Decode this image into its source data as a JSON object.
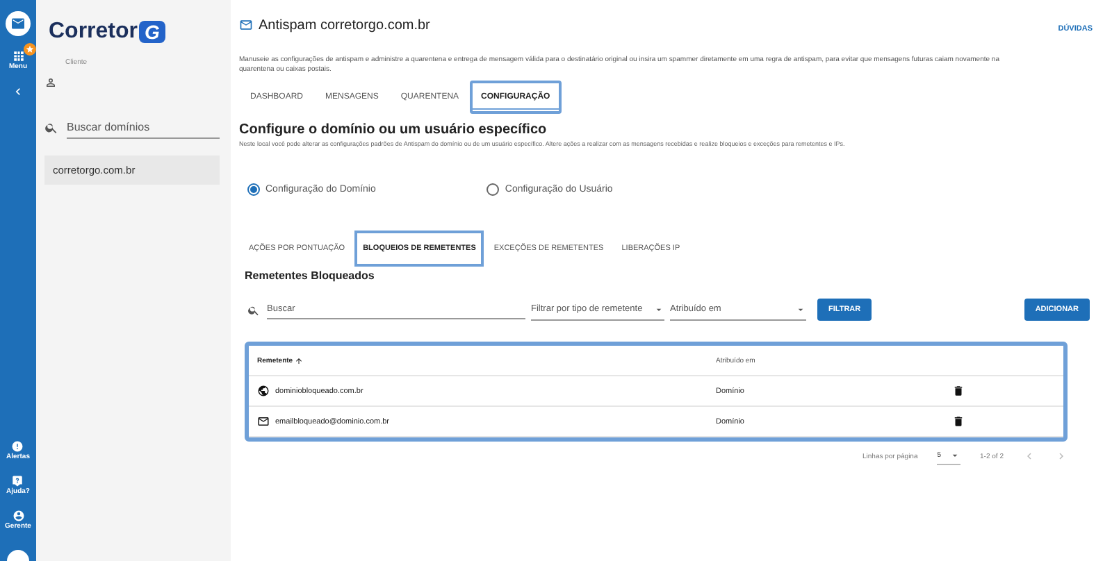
{
  "rail": {
    "top": [
      {
        "kind": "mail"
      },
      {
        "kind": "menu",
        "label": "Menu"
      },
      {
        "kind": "collapse"
      }
    ],
    "bottom": [
      {
        "kind": "alert",
        "label": "Alertas"
      },
      {
        "kind": "help",
        "label": "Ajuda?"
      },
      {
        "kind": "user",
        "label": "Gerente"
      }
    ]
  },
  "sidebar": {
    "logo": {
      "text": "Corretor",
      "badge": "G"
    },
    "client_label": "Cliente",
    "search": {
      "placeholder": "Buscar domínios"
    },
    "domains": [
      {
        "name": "corretorgo.com.br",
        "selected": true
      }
    ]
  },
  "header": {
    "title": "Antispam corretorgo.com.br",
    "help": "DÚVIDAS",
    "description": "Manuseie as configurações de antispam e administre a quarentena e entrega de mensagem válida para o destinatário original ou insira um spammer diretamente em uma regra de antispam, para evitar que mensagens futuras caiam novamente na quarentena ou caixas postais."
  },
  "tabs": [
    {
      "label": "DASHBOARD",
      "selected": false
    },
    {
      "label": "MENSAGENS",
      "selected": false
    },
    {
      "label": "QUARENTENA",
      "selected": false
    },
    {
      "label": "CONFIGURAÇÃO",
      "selected": true
    }
  ],
  "config": {
    "title": "Configure o domínio ou um usuário específico",
    "description": "Neste local você pode alterar as configurações padrões de Antispam do domínio ou de um usuário específico. Altere ações a realizar com as mensagens recebidas e realize bloqueios e exceções para remetentes e IPs.",
    "scope": [
      {
        "label": "Configuração do Domínio",
        "selected": true
      },
      {
        "label": "Configuração do Usuário",
        "selected": false
      }
    ]
  },
  "subtabs": [
    {
      "label": "AÇÕES POR PONTUAÇÃO",
      "selected": false
    },
    {
      "label": "BLOQUEIOS DE REMETENTES",
      "selected": true
    },
    {
      "label": "EXCEÇÕES DE REMETENTES",
      "selected": false
    },
    {
      "label": "LIBERAÇÕES IP",
      "selected": false
    }
  ],
  "section_title": "Remetentes Bloqueados",
  "filters": {
    "search": {
      "placeholder": "Buscar"
    },
    "type": {
      "placeholder": "Filtrar por tipo de remetente"
    },
    "assigned": {
      "placeholder": "Atribuído em"
    },
    "filter_button": "FILTRAR",
    "add_button": "ADICIONAR"
  },
  "table": {
    "highlighted": true,
    "columns": [
      "Remetente",
      "Atribuído em"
    ],
    "rows": [
      {
        "kind": "domain",
        "sender": "dominiobloqueado.com.br",
        "assigned": "Domínio"
      },
      {
        "kind": "email",
        "sender": "emailbloqueado@dominio.com.br",
        "assigned": "Domínio"
      }
    ]
  },
  "pagination": {
    "rows_label": "Linhas por página",
    "rows_value": "5",
    "range": "1-2 of 2"
  }
}
